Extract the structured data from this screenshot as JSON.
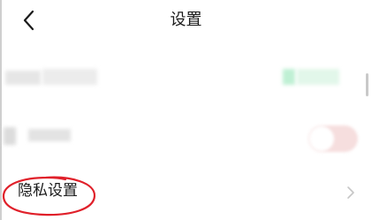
{
  "header": {
    "title": "设置",
    "back_icon": "chevron-left-icon"
  },
  "settings": {
    "row1": {
      "label": "",
      "value": "",
      "note": ""
    },
    "row2": {
      "label": "",
      "toggle_on": false
    },
    "row3": {
      "label": "隐私设置",
      "icon": "chevron-right-icon"
    }
  },
  "colors": {
    "annotation": "#e0202a",
    "toggle_track": "#f6dede",
    "blur_green": "#c6f2d9"
  }
}
